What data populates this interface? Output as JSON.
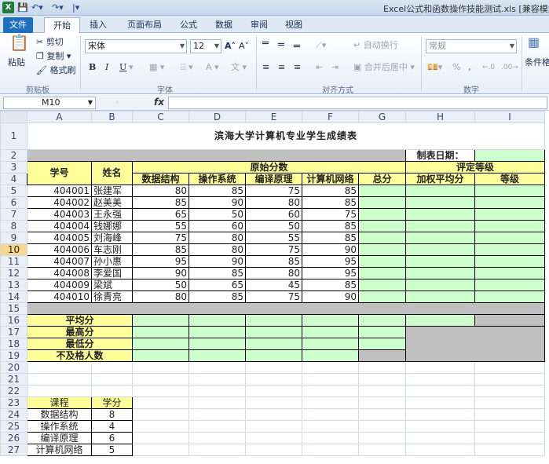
{
  "window": {
    "app_icon": "X",
    "quick_access": [
      "save-icon",
      "undo-icon",
      "redo-icon"
    ],
    "title": "Excel公式和函数操作技能测试.xls  [兼容模式"
  },
  "ribbon": {
    "tabs": [
      "文件",
      "开始",
      "插入",
      "页面布局",
      "公式",
      "数据",
      "审阅",
      "视图"
    ],
    "active_tab": "开始",
    "clipboard": {
      "paste": "粘贴",
      "cut": "剪切",
      "copy": "复制",
      "format_painter": "格式刷",
      "label": "剪贴板"
    },
    "font": {
      "name": "宋体",
      "size": "12",
      "bold": "B",
      "italic": "I",
      "underline": "U",
      "label": "字体"
    },
    "alignment": {
      "wrap": "自动换行",
      "merge": "合并后居中",
      "label": "对齐方式"
    },
    "number": {
      "format": "常规",
      "percent": "%",
      "comma": ",",
      "label": "数字"
    },
    "styles": {
      "conditional": "条件格"
    }
  },
  "formula_bar": {
    "name_box": "M10",
    "fx": "fx",
    "formula": ""
  },
  "columns": [
    "A",
    "B",
    "C",
    "D",
    "E",
    "F",
    "G",
    "H",
    "I"
  ],
  "rows": [
    "1",
    "2",
    "3",
    "4",
    "5",
    "6",
    "7",
    "8",
    "9",
    "10",
    "11",
    "12",
    "13",
    "14",
    "15",
    "16",
    "17",
    "18",
    "19",
    "20",
    "21",
    "22",
    "23",
    "24",
    "25",
    "26",
    "27"
  ],
  "active_row": "10",
  "sheet": {
    "title": "滨海大学计算机专业学生成绩表",
    "date_label": "制表日期：",
    "col_id": "学号",
    "col_name": "姓名",
    "raw_scores": "原始分数",
    "subjects": [
      "数据结构",
      "操作系统",
      "编译原理",
      "计算机网络"
    ],
    "total": "总分",
    "rating": "评定等级",
    "weighted_avg": "加权平均分",
    "grade": "等级",
    "students": [
      {
        "id": "404001",
        "name": "张建军",
        "scores": [
          "80",
          "85",
          "75",
          "85"
        ]
      },
      {
        "id": "404002",
        "name": "赵美美",
        "scores": [
          "85",
          "90",
          "80",
          "85"
        ]
      },
      {
        "id": "404003",
        "name": "王永强",
        "scores": [
          "65",
          "50",
          "60",
          "75"
        ]
      },
      {
        "id": "404004",
        "name": "钱娜娜",
        "scores": [
          "55",
          "60",
          "50",
          "85"
        ]
      },
      {
        "id": "404005",
        "name": "刘海峰",
        "scores": [
          "75",
          "80",
          "55",
          "85"
        ]
      },
      {
        "id": "404006",
        "name": "车志刚",
        "scores": [
          "85",
          "80",
          "75",
          "90"
        ]
      },
      {
        "id": "404007",
        "name": "孙小惠",
        "scores": [
          "95",
          "90",
          "85",
          "95"
        ]
      },
      {
        "id": "404008",
        "name": "李爱国",
        "scores": [
          "90",
          "85",
          "80",
          "95"
        ]
      },
      {
        "id": "404009",
        "name": "梁斌",
        "scores": [
          "50",
          "65",
          "45",
          "85"
        ]
      },
      {
        "id": "404010",
        "name": "徐青亮",
        "scores": [
          "80",
          "85",
          "75",
          "90"
        ]
      }
    ],
    "stats": [
      "平均分",
      "最高分",
      "最低分",
      "不及格人数"
    ],
    "credit_header": [
      "课程",
      "学分"
    ],
    "credits": [
      {
        "course": "数据结构",
        "credit": "8"
      },
      {
        "course": "操作系统",
        "credit": "4"
      },
      {
        "course": "编译原理",
        "credit": "6"
      },
      {
        "course": "计算机网络",
        "credit": "5"
      }
    ]
  }
}
